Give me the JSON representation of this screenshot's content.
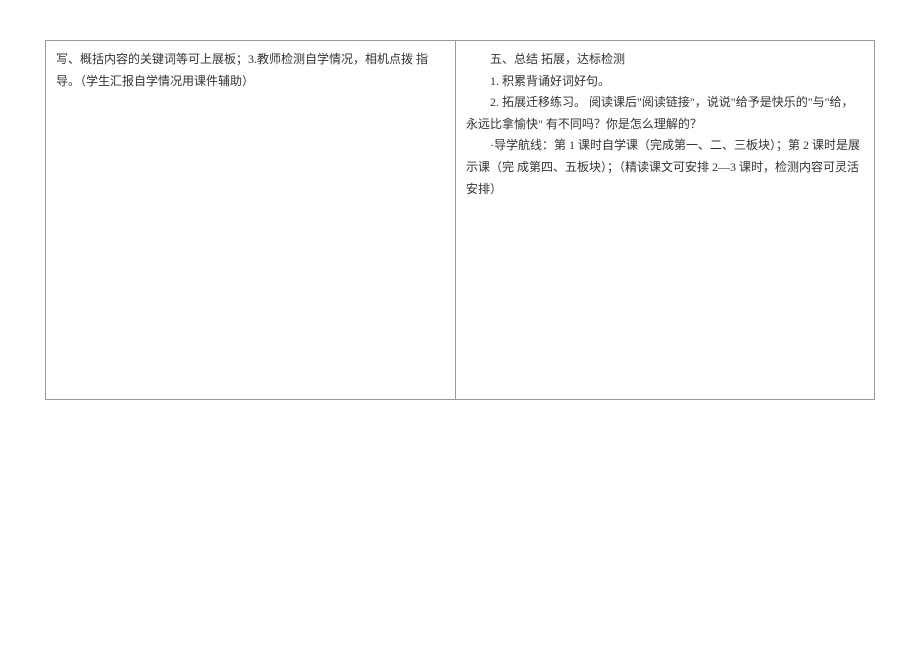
{
  "left": {
    "line1": "写、概括内容的关键词等可上展板；3.教师检测自学情况，相机点拨 指导。（学生汇报自学情况用课件辅助）"
  },
  "right": {
    "heading": "五、总结 拓展，达标检测",
    "item1": "1. 积累背诵好词好句。",
    "item2": "2. 拓展迁移练习。 阅读课后\"阅读链接\"，说说\"给予是快乐的\"与\"给，永远比拿愉快\" 有不同吗？你是怎么理解的？",
    "note": "·导学航线：第 1 课时自学课（完成第一、二、三板块）；第 2 课时是展示课（完 成第四、五板块）；（精读课文可安排 2—3 课时，检测内容可灵活安排）"
  }
}
